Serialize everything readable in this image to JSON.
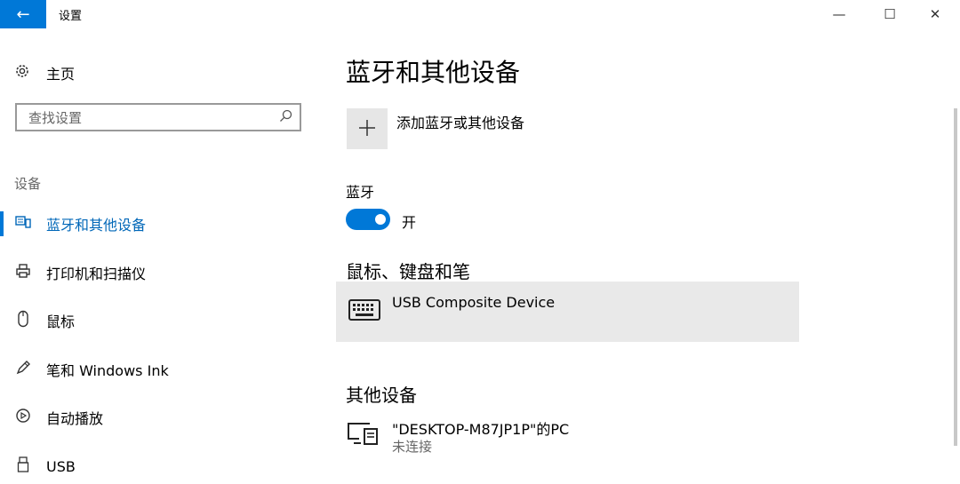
{
  "window": {
    "title": "设置",
    "back_glyph": "←",
    "min_glyph": "—",
    "max_glyph": "☐",
    "close_glyph": "✕"
  },
  "sidebar": {
    "home_label": "主页",
    "search_placeholder": "查找设置",
    "section_label": "设备",
    "items": [
      {
        "label": "蓝牙和其他设备",
        "icon": "bluetooth-devices-icon",
        "active": true
      },
      {
        "label": "打印机和扫描仪",
        "icon": "printer-icon",
        "active": false
      },
      {
        "label": "鼠标",
        "icon": "mouse-icon",
        "active": false
      },
      {
        "label": "笔和 Windows Ink",
        "icon": "pen-icon",
        "active": false
      },
      {
        "label": "自动播放",
        "icon": "autoplay-icon",
        "active": false
      },
      {
        "label": "USB",
        "icon": "usb-icon",
        "active": false
      }
    ]
  },
  "main": {
    "title": "蓝牙和其他设备",
    "add_device_label": "添加蓝牙或其他设备",
    "bluetooth_label": "蓝牙",
    "bluetooth_state": "开",
    "input_section_title": "鼠标、键盘和笔",
    "input_devices": [
      {
        "name": "USB Composite Device",
        "icon": "keyboard-icon"
      }
    ],
    "other_section_title": "其他设备",
    "other_devices": [
      {
        "name": "\"DESKTOP-M87JP1P\"的PC",
        "status": "未连接",
        "icon": "pc-icon"
      }
    ]
  },
  "colors": {
    "accent": "#0078d7",
    "active_text": "#0067b8",
    "selected_row": "#e9e9e9"
  }
}
